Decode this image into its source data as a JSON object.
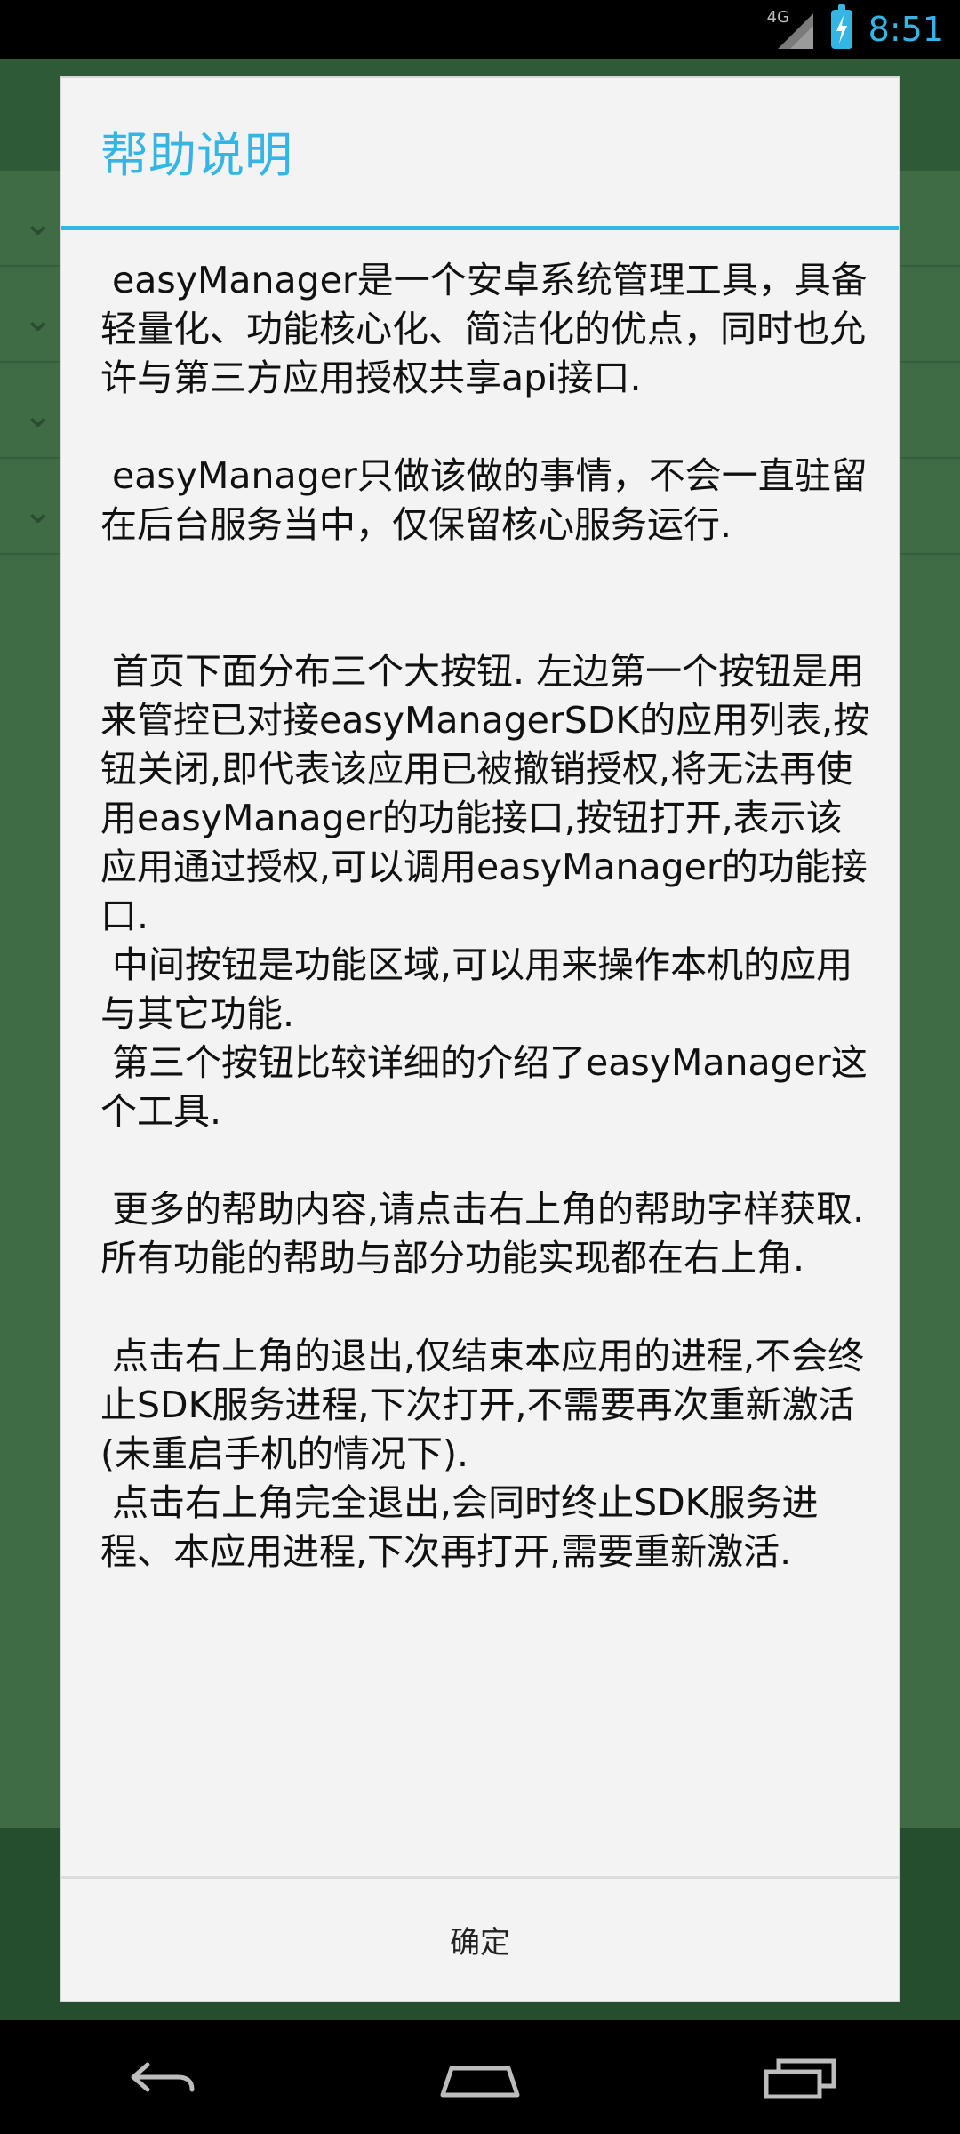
{
  "status_bar": {
    "network_label": "4G",
    "time": "8:51",
    "icons": [
      "signal-icon",
      "battery-charging-icon"
    ]
  },
  "dialog": {
    "title": "帮助说明",
    "body": " easyManager是一个安卓系统管理工具，具备轻量化、功能核心化、简洁化的优点，同时也允许与第三方应用授权共享api接口.\n\n easyManager只做该做的事情，不会一直驻留在后台服务当中，仅保留核心服务运行.\n\n\n 首页下面分布三个大按钮. 左边第一个按钮是用来管控已对接easyManagerSDK的应用列表,按钮关闭,即代表该应用已被撤销授权,将无法再使用easyManager的功能接口,按钮打开,表示该应用通过授权,可以调用easyManager的功能接口.\n 中间按钮是功能区域,可以用来操作本机的应用与其它功能.\n 第三个按钮比较详细的介绍了easyManager这个工具.\n\n 更多的帮助内容,请点击右上角的帮助字样获取.所有功能的帮助与部分功能实现都在右上角.\n\n 点击右上角的退出,仅结束本应用的进程,不会终止SDK服务进程,下次打开,不需要再次重新激活(未重启手机的情况下).\n 点击右上角完全退出,会同时终止SDK服务进程、本应用进程,下次再打开,需要重新激活.",
    "confirm_label": "确定"
  },
  "nav_bar": {
    "icons": [
      "back-icon",
      "home-icon",
      "recents-icon"
    ]
  },
  "colors": {
    "accent": "#33b5e5",
    "dialog_bg": "#f3f3f3",
    "app_bg_dimmed": "#3f6b45"
  }
}
